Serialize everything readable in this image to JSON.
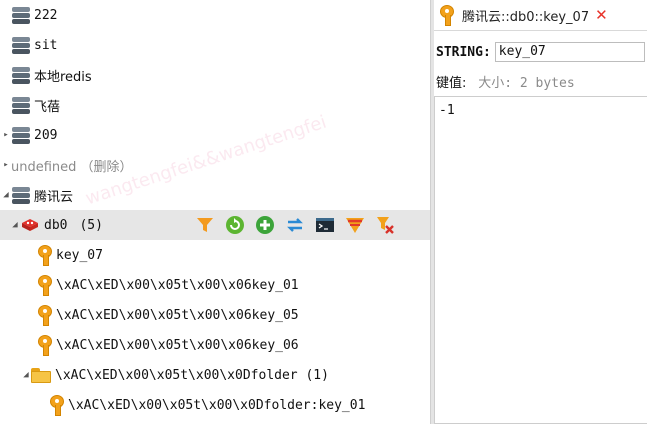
{
  "tree": {
    "servers": [
      {
        "label": "222",
        "expanded": false
      },
      {
        "label": "sit",
        "expanded": false
      },
      {
        "label": "本地redis",
        "expanded": false
      },
      {
        "label": "飞蓓",
        "expanded": false
      },
      {
        "label": "209",
        "expanded": false
      },
      {
        "label": "undefined （删除）",
        "expanded": false
      },
      {
        "label": "腾讯云",
        "expanded": true
      }
    ],
    "db": {
      "label": "db0",
      "count": "(5)"
    },
    "keys": [
      {
        "label": "key_07"
      },
      {
        "label": "\\xAC\\xED\\x00\\x05t\\x00\\x06key_01"
      },
      {
        "label": "\\xAC\\xED\\x00\\x05t\\x00\\x06key_05"
      },
      {
        "label": "\\xAC\\xED\\x00\\x05t\\x00\\x06key_06"
      }
    ],
    "folder": {
      "label": "\\xAC\\xED\\x00\\x05t\\x00\\x0Dfolder (1)"
    },
    "folder_keys": [
      {
        "label": "\\xAC\\xED\\x00\\x05t\\x00\\x0Dfolder:key_01"
      }
    ],
    "toolbar_icons": [
      "filter-icon",
      "reload-icon",
      "add-key-icon",
      "rename-icon",
      "console-icon",
      "flush-icon",
      "delete-icon"
    ]
  },
  "tab": {
    "title": "腾讯云::db0::key_07"
  },
  "editor": {
    "type_label": "STRING:",
    "key_name": "key_07",
    "meta_label": "键值:",
    "meta_size": "大小: 2 bytes",
    "value": "-1"
  },
  "watermark": {
    "text": "wangtengfei&&wangtengfei"
  },
  "colors": {
    "accent_key": "#f2a11b",
    "selected_row": "#e6e6e6",
    "close": "#e8332a"
  }
}
